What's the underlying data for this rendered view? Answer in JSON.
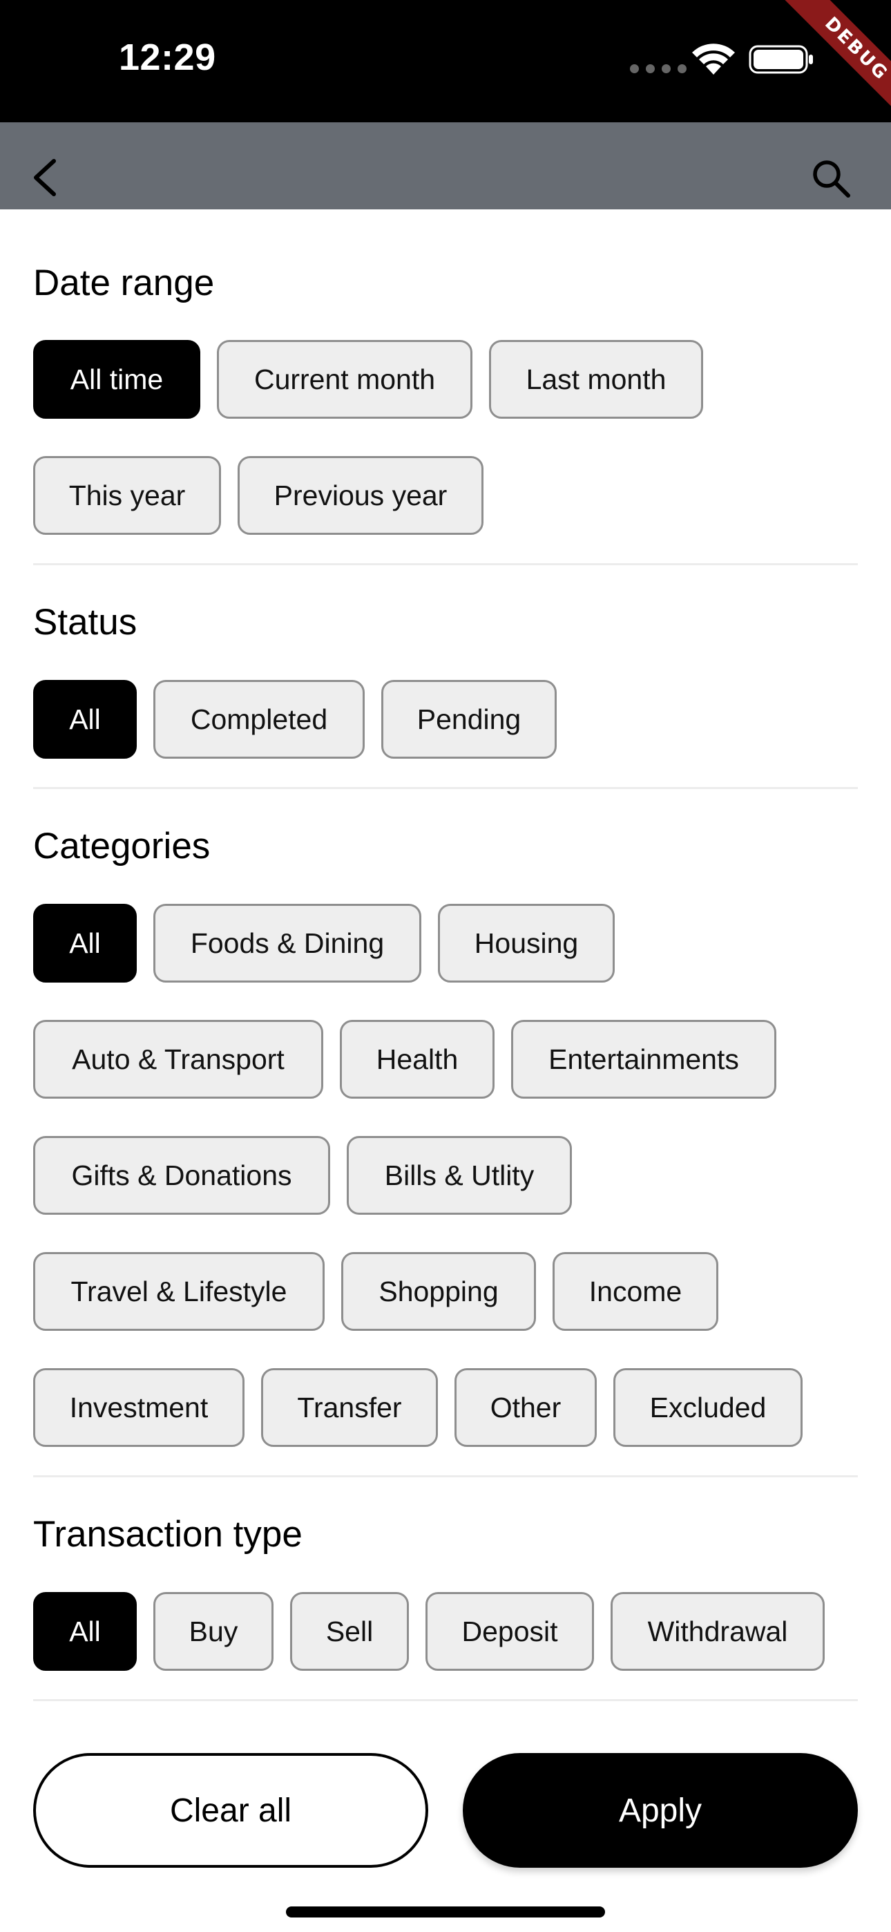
{
  "status_bar": {
    "time": "12:29"
  },
  "debug_banner": "DEBUG",
  "app_bar": {
    "back_icon": "chevron-left-icon",
    "search_icon": "search-icon",
    "background": "#676c73"
  },
  "sections": {
    "date_range": {
      "title": "Date range",
      "options": [
        "All time",
        "Current month",
        "Last month",
        "This year",
        "Previous year"
      ],
      "selected": "All time"
    },
    "status": {
      "title": "Status",
      "options": [
        "All",
        "Completed",
        "Pending"
      ],
      "selected": "All"
    },
    "categories": {
      "title": "Categories",
      "options": [
        "All",
        "Foods & Dining",
        "Housing",
        "Auto & Transport",
        "Health",
        "Entertainments",
        "Gifts & Donations",
        "Bills & Utlity",
        "Travel & Lifestyle",
        "Shopping",
        "Income",
        "Investment",
        "Transfer",
        "Other",
        "Excluded"
      ],
      "selected": "All"
    },
    "transaction_type": {
      "title": "Transaction type",
      "options": [
        "All",
        "Buy",
        "Sell",
        "Deposit",
        "Withdrawal"
      ],
      "selected": "All"
    }
  },
  "actions": {
    "clear_label": "Clear all",
    "apply_label": "Apply"
  },
  "colors": {
    "selected_chip": "#000000",
    "chip": "#eeeeee",
    "chip_border": "#8e8e8e"
  }
}
